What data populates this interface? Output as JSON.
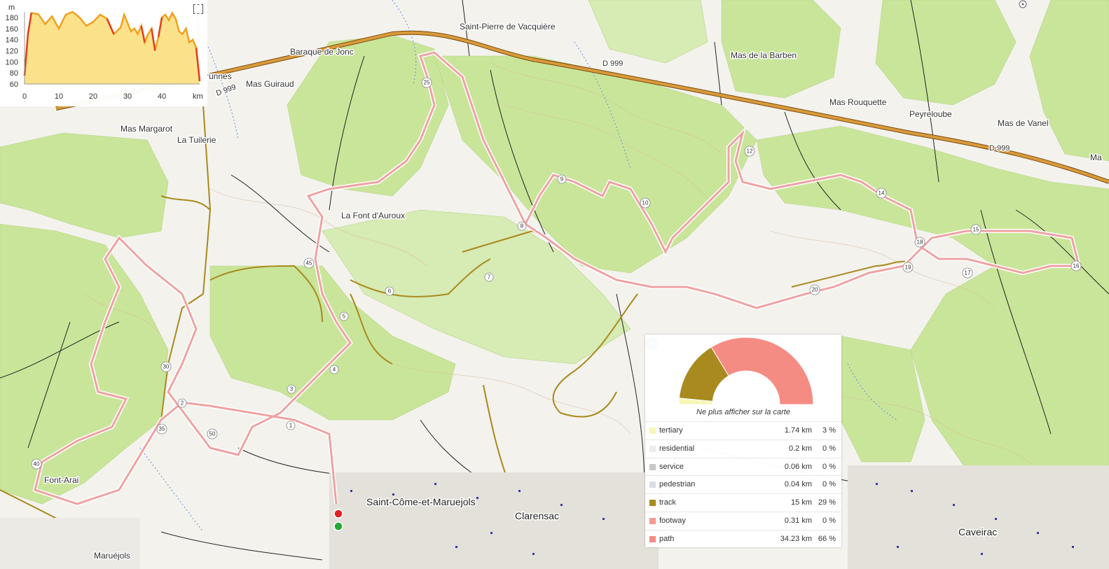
{
  "places": [
    {
      "label": "Saint-Pierre de Vacquière"
    },
    {
      "label": "Baraque de Jonc"
    },
    {
      "label": "Mas de la Barben"
    },
    {
      "label": "runnes"
    },
    {
      "label": "Mas Guiraud"
    },
    {
      "label": "Mas Rouquette"
    },
    {
      "label": "Peyreloube"
    },
    {
      "label": "Mas de Vanel"
    },
    {
      "label": "Mas Margarot"
    },
    {
      "label": "La Tuilerie"
    },
    {
      "label": "La Font d'Auroux"
    },
    {
      "label": "Font-Arai"
    },
    {
      "label": "Saint-Côme-et-Maruejols"
    },
    {
      "label": "Clarensac"
    },
    {
      "label": "Caveirac"
    },
    {
      "label": "Maruéjols"
    },
    {
      "label": "Ma"
    }
  ],
  "road_labels": [
    "D 999",
    "D 999",
    "D 999"
  ],
  "km_markers": [
    "1",
    "2",
    "3",
    "4",
    "5",
    "6",
    "7",
    "8",
    "9",
    "10",
    "12",
    "14",
    "15",
    "16",
    "17",
    "18",
    "19",
    "20",
    "25",
    "30",
    "35",
    "40",
    "45",
    "50"
  ],
  "elevation": {
    "y_axis_unit": "m",
    "x_axis_unit": "km",
    "y_ticks": [
      "180",
      "160",
      "140",
      "120",
      "100",
      "80",
      "60"
    ],
    "x_ticks": [
      "0",
      "10",
      "20",
      "30",
      "40"
    ]
  },
  "chart_data": {
    "type": "area",
    "title": "",
    "xlabel": "km",
    "ylabel": "m",
    "xlim": [
      0,
      51
    ],
    "ylim": [
      60,
      190
    ],
    "x": [
      0,
      1,
      2,
      4,
      6,
      8,
      10,
      12,
      14,
      16,
      18,
      20,
      22,
      24,
      26,
      28,
      29,
      30,
      31,
      32,
      33,
      34,
      35,
      36,
      37,
      38,
      39,
      40,
      41,
      42,
      43,
      44,
      45,
      46,
      47,
      48,
      49,
      50,
      51
    ],
    "values": [
      75,
      150,
      188,
      186,
      168,
      182,
      160,
      185,
      190,
      180,
      165,
      172,
      185,
      178,
      150,
      162,
      185,
      170,
      155,
      160,
      150,
      165,
      135,
      150,
      160,
      120,
      145,
      180,
      185,
      175,
      188,
      178,
      155,
      150,
      160,
      135,
      140,
      125,
      65
    ],
    "colors": {
      "fill": "#fbe28a",
      "line": "#f0a020",
      "steep": "#e04020"
    }
  },
  "stats": {
    "hide_label": "Ne plus afficher sur la carte",
    "rows": [
      {
        "name": "tertiary",
        "distance": "1.74 km",
        "percent": "3 %",
        "color": "#f7f7b8"
      },
      {
        "name": "residential",
        "distance": "0.2 km",
        "percent": "0 %",
        "color": "#ececec"
      },
      {
        "name": "service",
        "distance": "0.06 km",
        "percent": "0 %",
        "color": "#c8c8c8"
      },
      {
        "name": "pedestrian",
        "distance": "0.04 km",
        "percent": "0 %",
        "color": "#dcdce8"
      },
      {
        "name": "track",
        "distance": "15 km",
        "percent": "29 %",
        "color": "#a88a1e"
      },
      {
        "name": "footway",
        "distance": "0.31 km",
        "percent": "0 %",
        "color": "#f59b93"
      },
      {
        "name": "path",
        "distance": "34.23 km",
        "percent": "66 %",
        "color": "#f58c84"
      }
    ]
  },
  "colors": {
    "forest": "#c9e59a",
    "route": "#f2a3a3",
    "track": "#a88a1e",
    "major_road": "#c87f2a",
    "start_marker": "#22aa33",
    "end_marker": "#dd2222"
  }
}
